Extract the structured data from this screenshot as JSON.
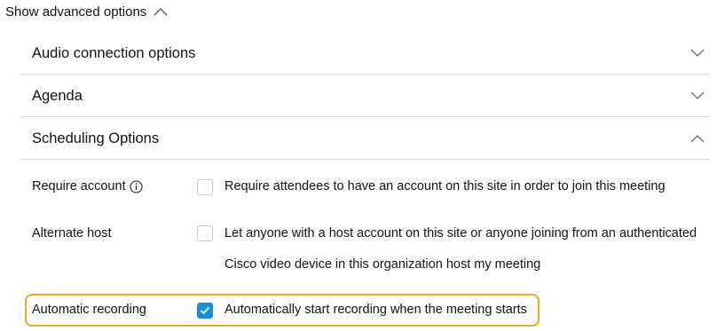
{
  "advanced": {
    "toggle_label": "Show advanced options",
    "expanded": true
  },
  "sections": [
    {
      "title": "Audio connection options",
      "expanded": false
    },
    {
      "title": "Agenda",
      "expanded": false
    },
    {
      "title": "Scheduling Options",
      "expanded": true
    }
  ],
  "scheduling": {
    "require_account": {
      "label": "Require account",
      "description": "Require attendees to have an account on this site in order to join this meeting",
      "checked": false
    },
    "alternate_host": {
      "label": "Alternate host",
      "description_line1": "Let anyone with a host account on this site or anyone joining from an authenticated",
      "description_line2": "Cisco video device in this organization host my meeting",
      "checked": false
    },
    "automatic_recording": {
      "label": "Automatic recording",
      "description": "Automatically start recording when the meeting starts",
      "checked": true
    }
  },
  "colors": {
    "checkbox_checked": "#1a8fd6",
    "highlight_border": "#f0a81e",
    "divider": "#dedede"
  },
  "icons": {
    "advanced_toggle": "chevron-up-icon",
    "section_collapsed": "chevron-down-icon",
    "section_expanded": "chevron-up-icon",
    "require_account_info": "info-icon",
    "checkbox_checked": "checkmark-icon"
  }
}
